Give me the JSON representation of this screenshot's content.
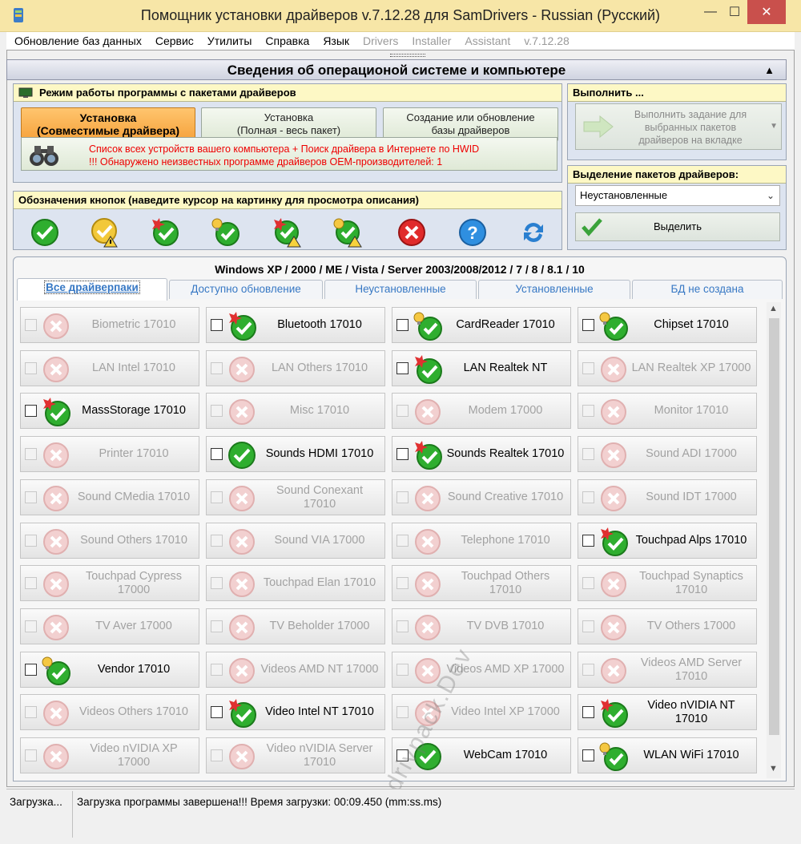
{
  "window": {
    "title": "Помощник установки драйверов v.7.12.28 для SamDrivers - Russian (Русский)",
    "minimize": "—",
    "maximize": "☐",
    "close": "✕"
  },
  "menu": {
    "items": [
      "Обновление баз данных",
      "Сервис",
      "Утилиты",
      "Справка",
      "Язык"
    ],
    "dim_items": [
      "Drivers",
      "Installer",
      "Assistant",
      "v.7.12.28"
    ]
  },
  "section": {
    "title": "Сведения об операционой системе и компьютере",
    "collapse": "▲"
  },
  "mode_panel": {
    "title": "Режим работы программы с пакетами драйверов",
    "buttons": [
      {
        "line1": "Установка",
        "line2": "(Совместимые драйвера)"
      },
      {
        "line1": "Установка",
        "line2": "(Полная - весь пакет)"
      },
      {
        "line1": "Создание или обновление",
        "line2": "базы драйверов"
      }
    ],
    "search_line1": "Список всех устройств вашего компьютера + Поиск драйвера в Интернете по HWID",
    "search_line2": "!!! Обнаружено неизвестных программе драйверов OEM-производителей: 1"
  },
  "legend_panel": {
    "title": "Обозначения кнопок (наведите курсор на картинку для просмотра описания)"
  },
  "exec_panel": {
    "title": "Выполнить ...",
    "button_line1": "Выполнить задание для",
    "button_line2": "выбранных пакетов",
    "button_line3": "драйверов на вкладке"
  },
  "select_panel": {
    "title": "Выделение пакетов драйверов:",
    "selected": "Неустановленные",
    "button": "Выделить"
  },
  "tabs_area": {
    "os_title": "Windows XP / 2000 / ME / Vista / Server 2003/2008/2012 / 7 / 8 / 8.1 / 10",
    "tabs": [
      "Все драйверпаки",
      "Доступно обновление",
      "Неустановленные",
      "Установленные",
      "БД не создана"
    ]
  },
  "packs": [
    {
      "l1": "Biometric 17010",
      "l2": "",
      "state": "disabled"
    },
    {
      "l1": "Bluetooth 17010",
      "l2": "",
      "state": "new"
    },
    {
      "l1": "CardReader 17010",
      "l2": "",
      "state": "bulb"
    },
    {
      "l1": "Chipset 17010",
      "l2": "",
      "state": "bulb"
    },
    {
      "l1": "LAN Intel 17010",
      "l2": "",
      "state": "disabled"
    },
    {
      "l1": "LAN Others 17010",
      "l2": "",
      "state": "disabled"
    },
    {
      "l1": "LAN Realtek NT",
      "l2": "",
      "state": "new"
    },
    {
      "l1": "LAN Realtek XP 17000",
      "l2": "",
      "state": "disabled"
    },
    {
      "l1": "MassStorage 17010",
      "l2": "",
      "state": "new"
    },
    {
      "l1": "Misc 17010",
      "l2": "",
      "state": "disabled"
    },
    {
      "l1": "Modem 17000",
      "l2": "",
      "state": "disabled"
    },
    {
      "l1": "Monitor 17010",
      "l2": "",
      "state": "disabled"
    },
    {
      "l1": "Printer 17010",
      "l2": "",
      "state": "disabled"
    },
    {
      "l1": "Sounds HDMI 17010",
      "l2": "",
      "state": "ok"
    },
    {
      "l1": "Sounds Realtek 17010",
      "l2": "",
      "state": "new"
    },
    {
      "l1": "Sound ADI 17000",
      "l2": "",
      "state": "disabled"
    },
    {
      "l1": "Sound CMedia 17010",
      "l2": "",
      "state": "disabled"
    },
    {
      "l1": "Sound Conexant",
      "l2": "17010",
      "state": "disabled"
    },
    {
      "l1": "Sound Creative 17010",
      "l2": "",
      "state": "disabled"
    },
    {
      "l1": "Sound IDT 17000",
      "l2": "",
      "state": "disabled"
    },
    {
      "l1": "Sound Others 17010",
      "l2": "",
      "state": "disabled"
    },
    {
      "l1": "Sound VIA 17000",
      "l2": "",
      "state": "disabled"
    },
    {
      "l1": "Telephone 17010",
      "l2": "",
      "state": "disabled"
    },
    {
      "l1": "Touchpad Alps 17010",
      "l2": "",
      "state": "new"
    },
    {
      "l1": "Touchpad Cypress",
      "l2": "17000",
      "state": "disabled"
    },
    {
      "l1": "Touchpad Elan 17010",
      "l2": "",
      "state": "disabled"
    },
    {
      "l1": "Touchpad Others",
      "l2": "17010",
      "state": "disabled"
    },
    {
      "l1": "Touchpad Synaptics",
      "l2": "17010",
      "state": "disabled"
    },
    {
      "l1": "TV Aver 17000",
      "l2": "",
      "state": "disabled"
    },
    {
      "l1": "TV Beholder 17000",
      "l2": "",
      "state": "disabled"
    },
    {
      "l1": "TV DVB 17010",
      "l2": "",
      "state": "disabled"
    },
    {
      "l1": "TV Others 17000",
      "l2": "",
      "state": "disabled"
    },
    {
      "l1": "Vendor 17010",
      "l2": "",
      "state": "bulb"
    },
    {
      "l1": "Videos AMD NT 17000",
      "l2": "",
      "state": "disabled"
    },
    {
      "l1": "Videos AMD XP 17000",
      "l2": "",
      "state": "disabled"
    },
    {
      "l1": "Videos AMD Server",
      "l2": "17010",
      "state": "disabled"
    },
    {
      "l1": "Videos Others 17010",
      "l2": "",
      "state": "disabled"
    },
    {
      "l1": "Video Intel NT 17010",
      "l2": "",
      "state": "new"
    },
    {
      "l1": "Video Intel XP 17000",
      "l2": "",
      "state": "disabled"
    },
    {
      "l1": "Video nVIDIA NT",
      "l2": "17010",
      "state": "new"
    },
    {
      "l1": "Video nVIDIA XP",
      "l2": "17000",
      "state": "disabled"
    },
    {
      "l1": "Video nVIDIA Server",
      "l2": "17010",
      "state": "disabled"
    },
    {
      "l1": "WebCam 17010",
      "l2": "",
      "state": "ok"
    },
    {
      "l1": "WLAN WiFi 17010",
      "l2": "",
      "state": "bulb"
    }
  ],
  "status": {
    "left": "Загрузка...",
    "message": "Загрузка программы завершена!!! Время загрузки: 00:09.450 (mm:ss.ms)"
  },
  "watermark": "drivpack.Dev",
  "colors": {
    "accent": "#f6a23c",
    "ok_green": "#2fae2f",
    "error_red": "#e02b2b",
    "panel_header": "#fdf8c5"
  }
}
